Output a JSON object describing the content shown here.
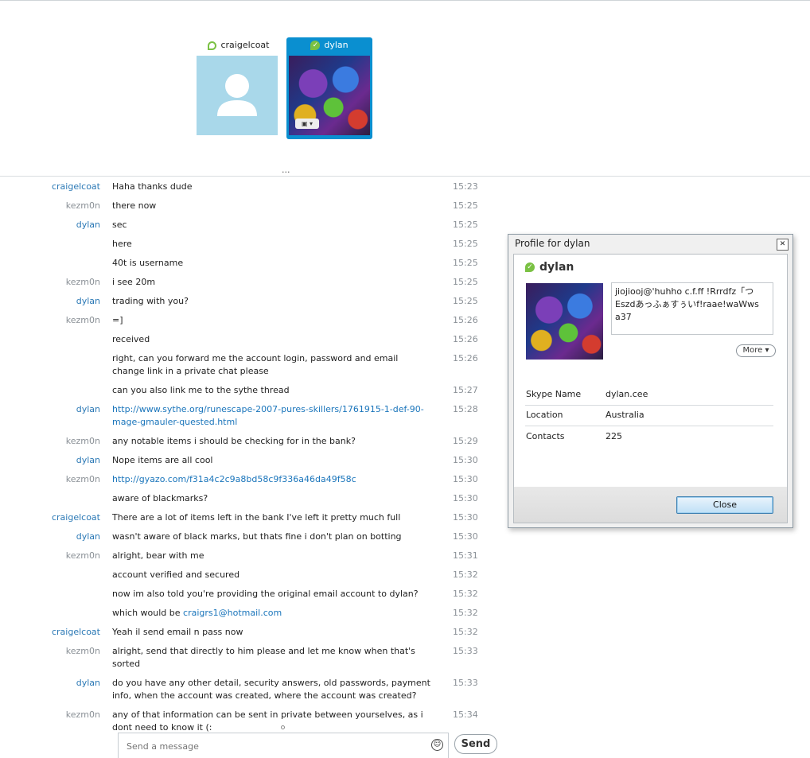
{
  "participants": [
    {
      "name": "craigelcoat",
      "status": "online-ring"
    },
    {
      "name": "dylan",
      "status": "online",
      "selected": true
    }
  ],
  "messages": [
    {
      "sender": "craigelcoat",
      "text": "Haha thanks dude",
      "time": "15:23"
    },
    {
      "sender": "kezm0n",
      "text": "there now",
      "time": "15:25"
    },
    {
      "sender": "dylan",
      "text": "sec",
      "time": "15:25"
    },
    {
      "sender": "",
      "text": "here",
      "time": "15:25"
    },
    {
      "sender": "",
      "text": "40t is username",
      "time": "15:25"
    },
    {
      "sender": "kezm0n",
      "text": "i see 20m",
      "time": "15:25"
    },
    {
      "sender": "dylan",
      "text": "trading with you?",
      "time": "15:25"
    },
    {
      "sender": "kezm0n",
      "text": "=]",
      "time": "15:26"
    },
    {
      "sender": "",
      "text": "received",
      "time": "15:26"
    },
    {
      "sender": "",
      "text": "right, can you forward me the account login, password and email change link in a private chat please",
      "time": "15:26"
    },
    {
      "sender": "",
      "text": "can you also link me to the sythe thread",
      "time": "15:27"
    },
    {
      "sender": "dylan",
      "link": "http://www.sythe.org/runescape-2007-pures-skillers/1761915-1-def-90-mage-gmauler-quested.html",
      "time": "15:28"
    },
    {
      "sender": "kezm0n",
      "text": "any notable items i should be checking for in the bank?",
      "time": "15:29"
    },
    {
      "sender": "dylan",
      "text": "Nope items are all cool",
      "time": "15:30"
    },
    {
      "sender": "kezm0n",
      "link": "http://gyazo.com/f31a4c2c9a8bd58c9f336a46da49f58c",
      "time": "15:30"
    },
    {
      "sender": "",
      "text": "aware of blackmarks?",
      "time": "15:30"
    },
    {
      "sender": "craigelcoat",
      "text": "There are a lot of items left in the bank I've left it pretty much full",
      "time": "15:30"
    },
    {
      "sender": "dylan",
      "text": "wasn't aware of black marks, but thats fine i don't plan on botting",
      "time": "15:30"
    },
    {
      "sender": "kezm0n",
      "text": "alright, bear with me",
      "time": "15:31"
    },
    {
      "sender": "",
      "text": "account verified and secured",
      "time": "15:32"
    },
    {
      "sender": "",
      "text": "now im also told you're providing the original email account to dylan?",
      "time": "15:32"
    },
    {
      "sender": "",
      "text": "which would be ",
      "link": "craigrs1@hotmail.com",
      "time": "15:32"
    },
    {
      "sender": "craigelcoat",
      "text": "Yeah il send email n pass now",
      "time": "15:32"
    },
    {
      "sender": "kezm0n",
      "text": "alright, send that directly to him please and let me know when that's sorted",
      "time": "15:33"
    },
    {
      "sender": "dylan",
      "text": "do you have any other detail, security answers, old passwords, payment info, when the account was created, where the account was created?",
      "time": "15:33"
    },
    {
      "sender": "kezm0n",
      "text": "any of that information can be sent in private between yourselves, as i dont need to know it (:",
      "time": "15:34"
    }
  ],
  "composer": {
    "placeholder": "Send a message",
    "send_label": "Send"
  },
  "profile": {
    "title": "Profile for dylan",
    "name": "dylan",
    "mood": "jiojiooj@'huhho c.f.ff !Rrrdfz「つEszdあっふぁすぅいf!raae!waWws a37",
    "more_label": "More",
    "fields": [
      {
        "key": "Skype Name",
        "value": "dylan.cee"
      },
      {
        "key": "Location",
        "value": "Australia"
      },
      {
        "key": "Contacts",
        "value": "225"
      }
    ],
    "close_label": "Close"
  },
  "colors": {
    "accent": "#0a8fd0",
    "link": "#1a75bb",
    "online": "#7ac143",
    "avatar_bg": "#a9d8ea"
  }
}
